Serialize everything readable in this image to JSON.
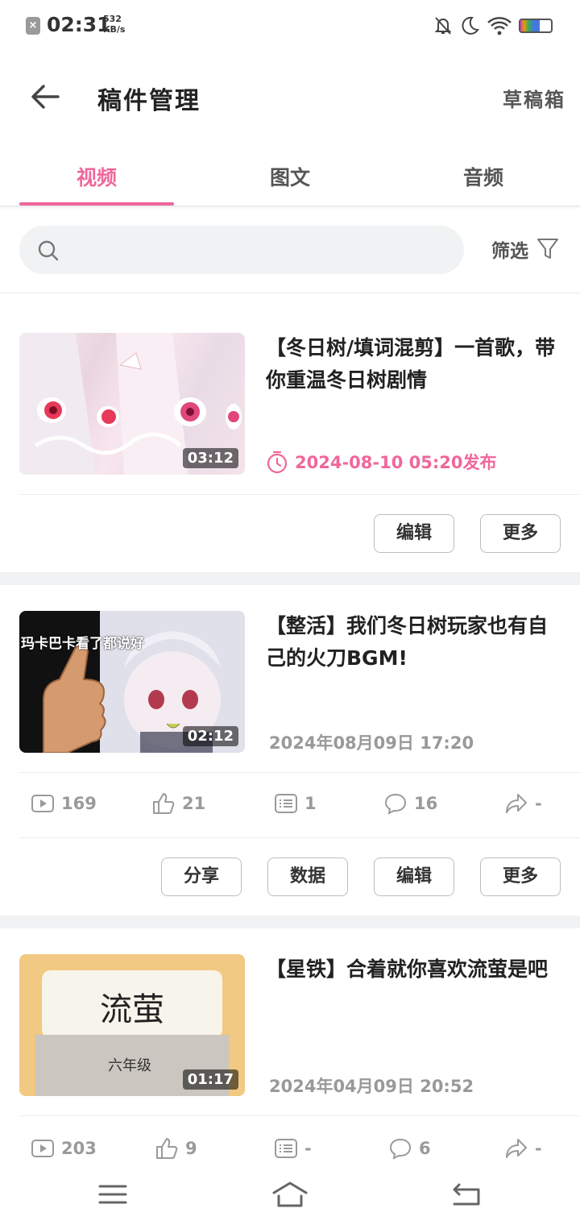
{
  "status": {
    "time": "02:31",
    "net_speed": "532",
    "net_unit": "KB/s"
  },
  "header": {
    "title": "稿件管理",
    "drafts_label": "草稿箱"
  },
  "tabs": [
    {
      "label": "视频"
    },
    {
      "label": "图文"
    },
    {
      "label": "音频"
    }
  ],
  "search": {
    "placeholder": ""
  },
  "filter_label": "筛选",
  "colors": {
    "accent": "#f0679a",
    "muted": "#9a9a9a"
  },
  "videos": [
    {
      "title": "【冬日树/填词混剪】一首歌，带你重温冬日树剧情",
      "duration": "03:12",
      "time": "2024-08-10  05:20发布",
      "scheduled": true,
      "buttons": {
        "edit": "编辑",
        "more": "更多"
      }
    },
    {
      "title": "【整活】我们冬日树玩家也有自己的火刀BGM!",
      "duration": "02:12",
      "thumb_text": "玛卡巴卡看了都说好",
      "time": "2024年08月09日  17:20",
      "stats": {
        "plays": "169",
        "likes": "21",
        "danmaku": "1",
        "comments": "16",
        "shares": "-"
      },
      "buttons": {
        "share": "分享",
        "data": "数据",
        "edit": "编辑",
        "more": "更多"
      }
    },
    {
      "title": "【星铁】合着就你喜欢流萤是吧",
      "duration": "01:17",
      "thumb_text": "流萤",
      "thumb_sub": "六年级",
      "time": "2024年04月09日  20:52",
      "stats": {
        "plays": "203",
        "likes": "9",
        "danmaku": "-",
        "comments": "6",
        "shares": "-"
      }
    }
  ]
}
